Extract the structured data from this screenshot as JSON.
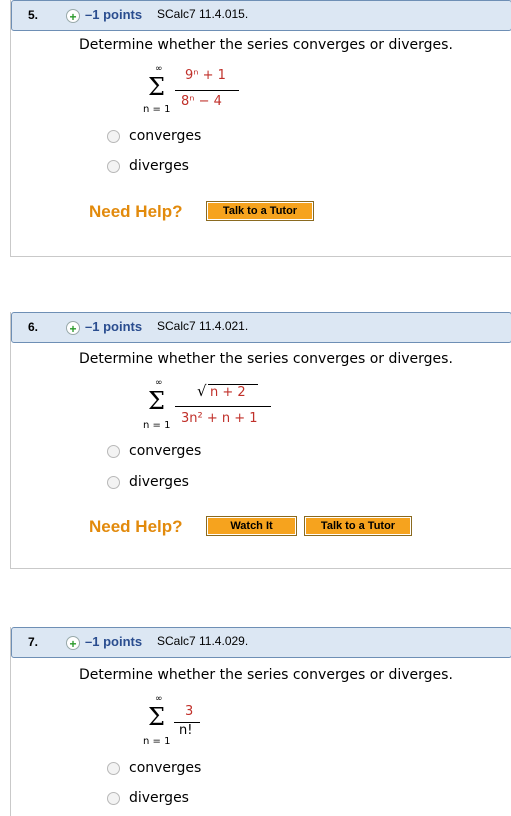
{
  "questions": [
    {
      "number": "5.",
      "points": "–1 points",
      "source": "SCalc7 11.4.015.",
      "prompt": "Determine whether the series converges or diverges.",
      "sum_upper": "∞",
      "sum_lower": "n = 1",
      "numerator": "9ⁿ + 1",
      "denominator": "8ⁿ − 4",
      "options": [
        "converges",
        "diverges"
      ],
      "help": "Need Help?",
      "buttons": [
        "Talk to a Tutor"
      ]
    },
    {
      "number": "6.",
      "points": "–1 points",
      "source": "SCalc7 11.4.021.",
      "prompt": "Determine whether the series converges or diverges.",
      "sum_upper": "∞",
      "sum_lower": "n = 1",
      "numerator": "n + 2",
      "denominator": "3n² + n + 1",
      "options": [
        "converges",
        "diverges"
      ],
      "help": "Need Help?",
      "buttons": [
        "Watch It",
        "Talk to a Tutor"
      ]
    },
    {
      "number": "7.",
      "points": "–1 points",
      "source": "SCalc7 11.4.029.",
      "prompt": "Determine whether the series converges or diverges.",
      "sum_upper": "∞",
      "sum_lower": "n = 1",
      "numerator": "3",
      "denominator": "n!",
      "options": [
        "converges",
        "diverges"
      ]
    }
  ]
}
